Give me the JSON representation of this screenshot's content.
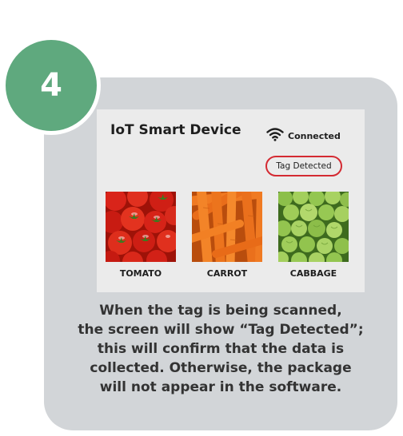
{
  "step": {
    "number": "4",
    "color": "#5fa97e"
  },
  "device": {
    "title": "IoT Smart Device",
    "status_icon": "wifi-icon",
    "status_text": "Connected",
    "tag_badge": "Tag Detected",
    "tag_badge_color": "#d42a32",
    "products": [
      {
        "label": "TOMATO",
        "image": "tomato-image"
      },
      {
        "label": "CARROT",
        "image": "carrot-image"
      },
      {
        "label": "CABBAGE",
        "image": "cabbage-image"
      }
    ]
  },
  "caption": {
    "lines": [
      "When the tag is being scanned,",
      "the screen will show “Tag Detected”;",
      "this will confirm that the data is",
      "collected. Otherwise, the package",
      "will not appear in the software."
    ]
  }
}
